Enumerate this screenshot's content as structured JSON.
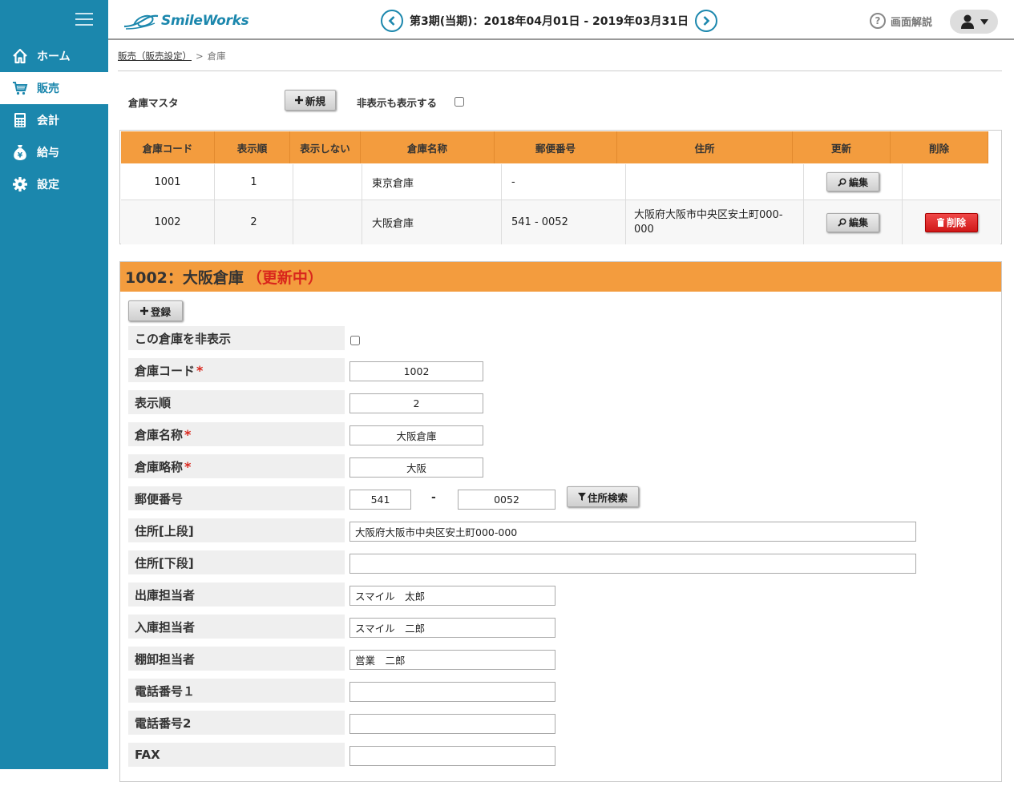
{
  "app": {
    "logo_text": "SmileWorks"
  },
  "header": {
    "period": "第3期(当期)：2018年04月01日 - 2019年03月31日",
    "help_label": "画面解説"
  },
  "sidebar": {
    "items": [
      {
        "label": "ホーム",
        "icon": "home-icon"
      },
      {
        "label": "販売",
        "icon": "cart-icon",
        "active": true
      },
      {
        "label": "会計",
        "icon": "calculator-icon"
      },
      {
        "label": "給与",
        "icon": "money-bag-icon"
      },
      {
        "label": "設定",
        "icon": "gear-icon"
      }
    ]
  },
  "breadcrumb": {
    "parent": "販売（販売設定）",
    "separator": ">",
    "current": "倉庫"
  },
  "toolbar": {
    "title": "倉庫マスタ",
    "new_label": "新規",
    "show_hidden_label": "非表示も表示する"
  },
  "table": {
    "headers": [
      "倉庫コード",
      "表示順",
      "表示しない",
      "倉庫名称",
      "郵便番号",
      "住所",
      "更新",
      "削除"
    ],
    "rows": [
      {
        "code": "1001",
        "order": "1",
        "hidden": "",
        "name": "東京倉庫",
        "zip": "-",
        "address": "",
        "edit": "編集",
        "delete": ""
      },
      {
        "code": "1002",
        "order": "2",
        "hidden": "",
        "name": "大阪倉庫",
        "zip": "541 - 0052",
        "address": "大阪府大阪市中央区安土町000-000",
        "edit": "編集",
        "delete": "削除"
      }
    ]
  },
  "edit": {
    "title": "1002：大阪倉庫",
    "status": "（更新中）",
    "register_label": "登録",
    "required_mark": "*",
    "fields": {
      "hide": {
        "label": "この倉庫を非表示"
      },
      "code": {
        "label": "倉庫コード",
        "value": "1002"
      },
      "order": {
        "label": "表示順",
        "value": "2"
      },
      "name": {
        "label": "倉庫名称",
        "value": "大阪倉庫"
      },
      "short_name": {
        "label": "倉庫略称",
        "value": "大阪"
      },
      "zip": {
        "label": "郵便番号",
        "value1": "541",
        "dash": "-",
        "value2": "0052",
        "search_label": "住所検索"
      },
      "address1": {
        "label": "住所[上段]",
        "value": "大阪府大阪市中央区安土町000-000"
      },
      "address2": {
        "label": "住所[下段]",
        "value": ""
      },
      "shipper": {
        "label": "出庫担当者",
        "value": "スマイル　太郎"
      },
      "receiver": {
        "label": "入庫担当者",
        "value": "スマイル　二郎"
      },
      "stocktaker": {
        "label": "棚卸担当者",
        "value": "営業　二郎"
      },
      "phone1": {
        "label": "電話番号１",
        "value": ""
      },
      "phone2": {
        "label": "電話番号2",
        "value": ""
      },
      "fax": {
        "label": "FAX",
        "value": ""
      }
    }
  },
  "colors": {
    "sidebar": "#1b87ad",
    "accent_orange": "#f39c3e",
    "danger": "#d9261c"
  }
}
